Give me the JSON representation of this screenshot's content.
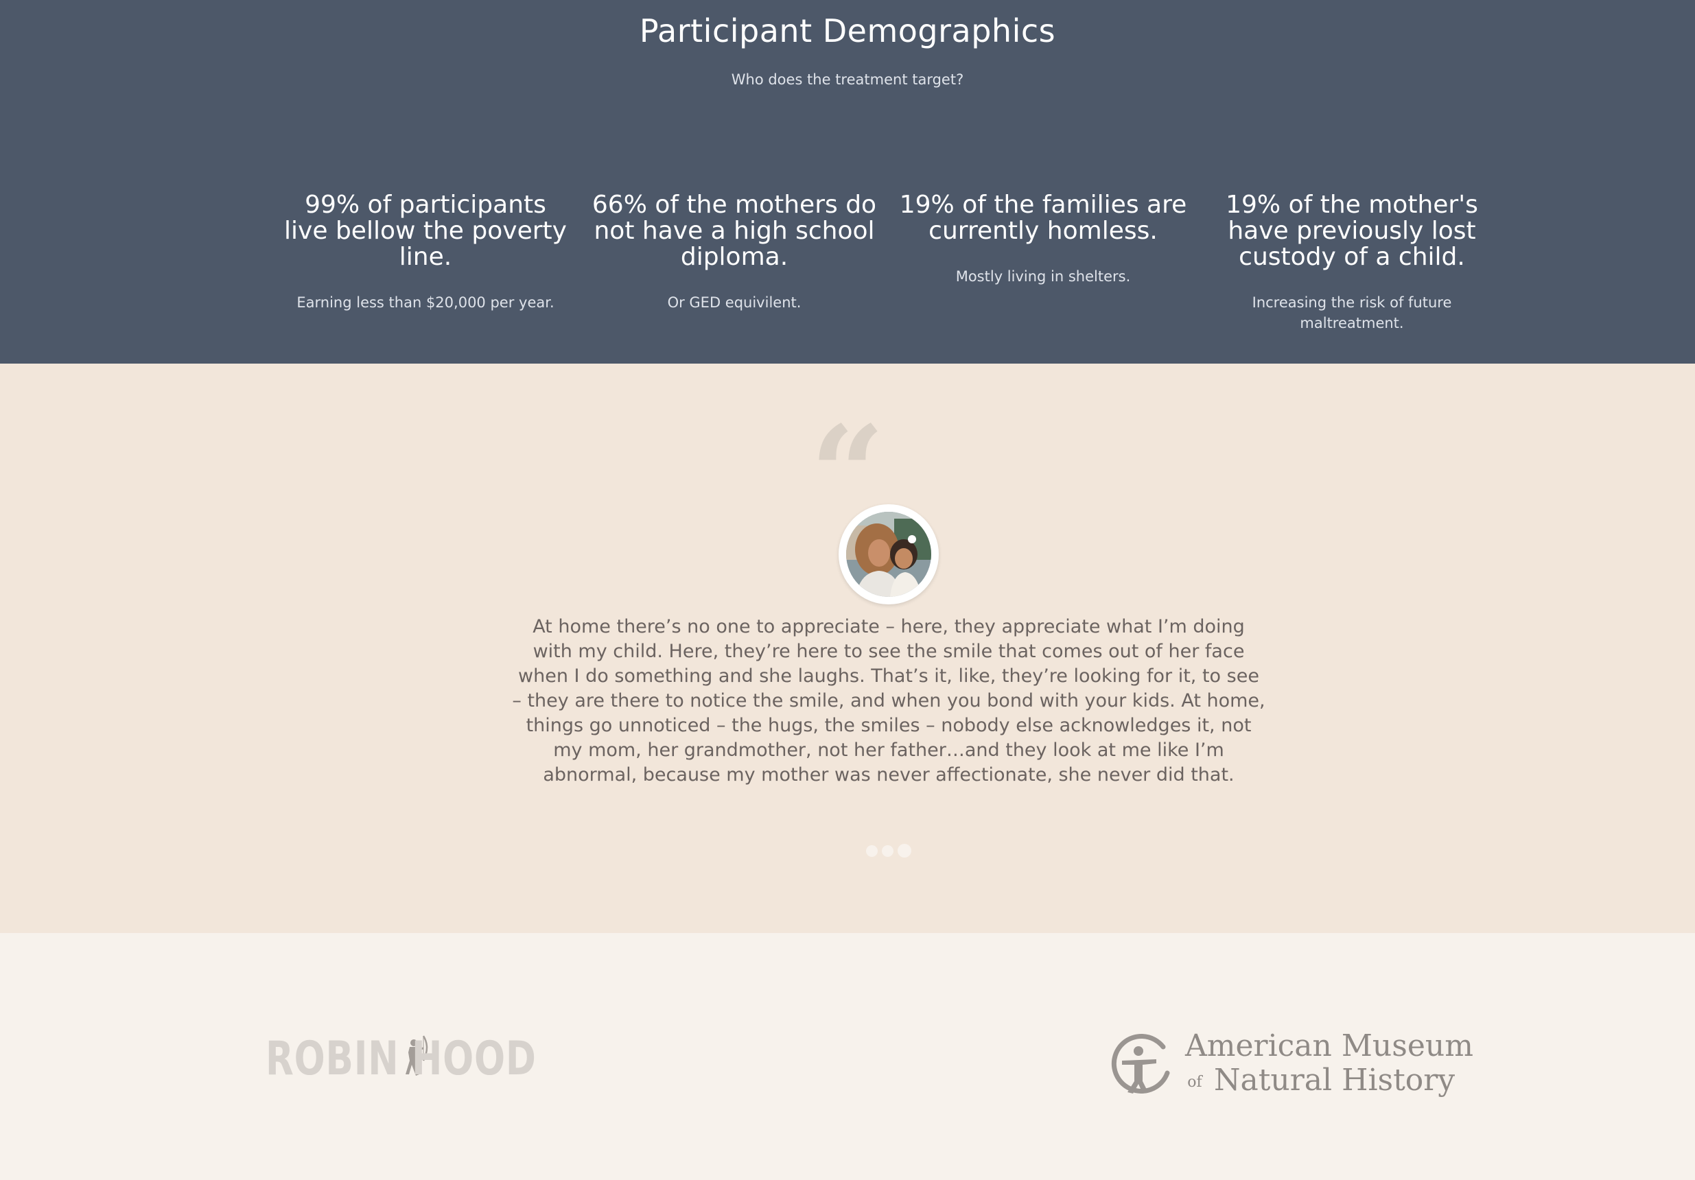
{
  "demographics": {
    "title": "Participant Demographics",
    "subtitle": "Who does the treatment target?",
    "stats": [
      {
        "heading": "99% of participants live bellow the poverty line.",
        "note": "Earning less than $20,000 per year."
      },
      {
        "heading": "66% of the mothers do not have a high school diploma.",
        "note": "Or GED equivilent."
      },
      {
        "heading": "19% of the families are currently homless.",
        "note": "Mostly living in shelters."
      },
      {
        "heading": "19% of the mother's have previously lost custody of a child.",
        "note": "Increasing the risk of future maltreatment."
      }
    ]
  },
  "testimonial": {
    "quote_icon": "quote-icon",
    "quote": "At home there’s no one to appreciate – here, they appreciate what I’m doing with my child. Here, they’re here to see the smile that comes out of her face when I do something and she laughs. That’s it, like, they’re looking for it, to see – they are there to notice the smile, and when you bond with your kids. At home, things go unnoticed – the hugs, the smiles – nobody else acknowledges it, not my mom, her grandmother, not her father…and they look at me like I’m abnormal, because my mother was never affectionate, she never did that.",
    "pagination": {
      "count": 3,
      "active": 3
    }
  },
  "partners": {
    "robinhood": {
      "left": "ROBIN",
      "right": "HOOD"
    },
    "amnh": {
      "line1": "American Museum",
      "of": "of",
      "line2": "Natural History"
    }
  },
  "colors": {
    "header_bg": "#4d5869",
    "testimonial_bg": "#f2e6da",
    "footer_bg": "#f7f2ec"
  }
}
